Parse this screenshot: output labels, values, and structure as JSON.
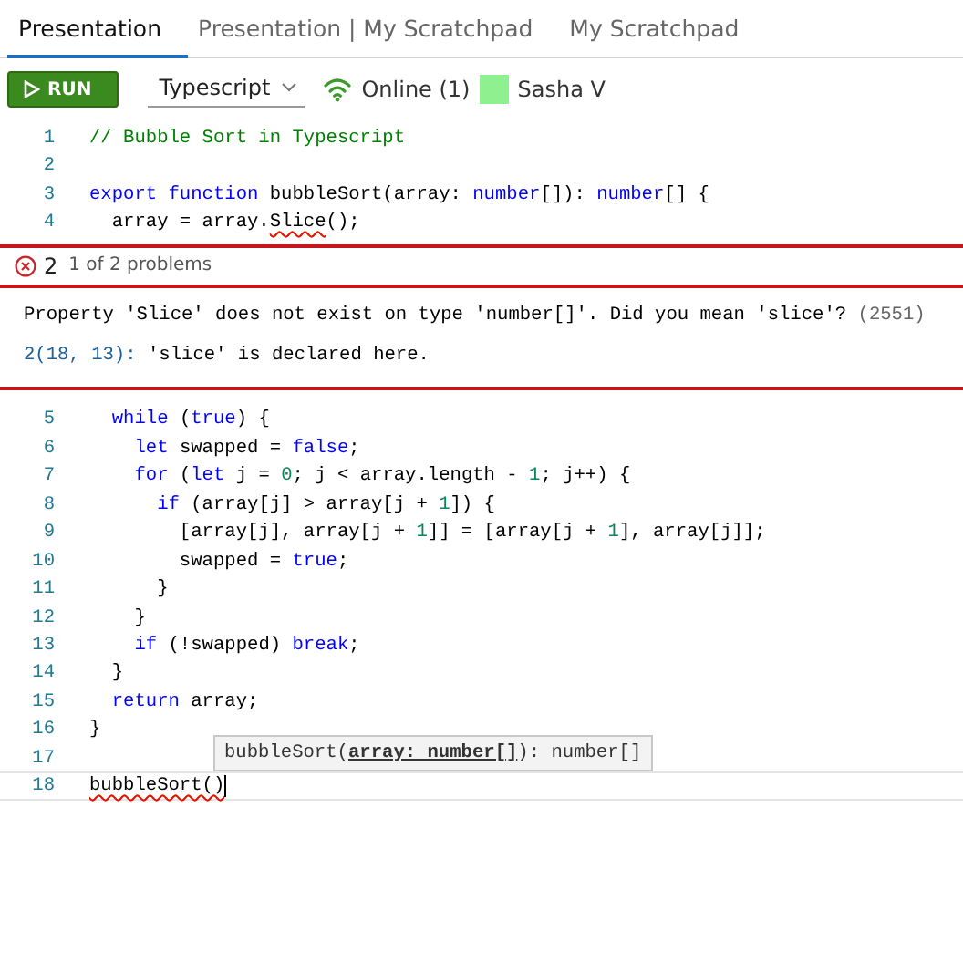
{
  "tabs": [
    {
      "label": "Presentation",
      "selected": true
    },
    {
      "label": "Presentation | My Scratchpad",
      "selected": false
    },
    {
      "label": "My Scratchpad",
      "selected": false
    }
  ],
  "toolbar": {
    "run_button": "RUN",
    "language": "Typescript",
    "status": "Online (1)",
    "user": {
      "name": "Sasha V",
      "color": "#8ef08e"
    }
  },
  "editor": {
    "lines_before": [
      {
        "number": "1",
        "current": false,
        "tokens": [
          {
            "text": "// Bubble Sort in Typescript",
            "kind": "comment"
          }
        ]
      },
      {
        "number": "2",
        "current": false
      },
      {
        "number": "3",
        "current": false,
        "tokens": [
          {
            "text": "export",
            "kind": "keyword"
          },
          {
            "text": " function",
            "kind": "keyword"
          },
          {
            "text": " bubbleSort(array: ",
            "kind": "plain"
          },
          {
            "text": "number",
            "kind": "keyword"
          },
          {
            "text": "[]): ",
            "kind": "plain"
          },
          {
            "text": "number",
            "kind": "keyword"
          },
          {
            "text": "[] {",
            "kind": "plain"
          }
        ]
      },
      {
        "number": "4",
        "current": false,
        "tokens": [
          {
            "text": "  array = array.",
            "kind": "plain"
          },
          {
            "text": "Slice",
            "kind": "error"
          },
          {
            "text": "();",
            "kind": "plain"
          }
        ]
      }
    ],
    "problem_peek": {
      "count": "2",
      "position": "1 of 2 problems",
      "message": "Property 'Slice' does not exist on type 'number[]'. Did you mean 'slice'?",
      "code": "(2551)",
      "related_location": "2(18, 13):",
      "related_message": "'slice' is declared here."
    },
    "lines_after": [
      {
        "number": "5",
        "current": false,
        "tokens": [
          {
            "text": "  while",
            "kind": "keyword"
          },
          {
            "text": " (",
            "kind": "plain"
          },
          {
            "text": "true",
            "kind": "keyword"
          },
          {
            "text": ") {",
            "kind": "plain"
          }
        ]
      },
      {
        "number": "6",
        "current": false,
        "tokens": [
          {
            "text": "    let",
            "kind": "keyword"
          },
          {
            "text": " swapped = ",
            "kind": "plain"
          },
          {
            "text": "false",
            "kind": "keyword"
          },
          {
            "text": ";",
            "kind": "plain"
          }
        ]
      },
      {
        "number": "7",
        "current": false,
        "tokens": [
          {
            "text": "    for",
            "kind": "keyword"
          },
          {
            "text": " (",
            "kind": "plain"
          },
          {
            "text": "let",
            "kind": "keyword"
          },
          {
            "text": " j = ",
            "kind": "plain"
          },
          {
            "text": "0",
            "kind": "number"
          },
          {
            "text": "; j < array.length - ",
            "kind": "plain"
          },
          {
            "text": "1",
            "kind": "number"
          },
          {
            "text": "; j++) {",
            "kind": "plain"
          }
        ]
      },
      {
        "number": "8",
        "current": false,
        "tokens": [
          {
            "text": "      if",
            "kind": "keyword"
          },
          {
            "text": " (array[j] > array[j + ",
            "kind": "plain"
          },
          {
            "text": "1",
            "kind": "number"
          },
          {
            "text": "]) {",
            "kind": "plain"
          }
        ]
      },
      {
        "number": "9",
        "current": false,
        "tokens": [
          {
            "text": "        [array[j], array[j + ",
            "kind": "plain"
          },
          {
            "text": "1",
            "kind": "number"
          },
          {
            "text": "]] = [array[j + ",
            "kind": "plain"
          },
          {
            "text": "1",
            "kind": "number"
          },
          {
            "text": "], array[j]];",
            "kind": "plain"
          }
        ]
      },
      {
        "number": "10",
        "current": false,
        "tokens": [
          {
            "text": "        swapped = ",
            "kind": "plain"
          },
          {
            "text": "true",
            "kind": "keyword"
          },
          {
            "text": ";",
            "kind": "plain"
          }
        ]
      },
      {
        "number": "11",
        "current": false,
        "tokens": [
          {
            "text": "      }",
            "kind": "plain"
          }
        ]
      },
      {
        "number": "12",
        "current": false,
        "tokens": [
          {
            "text": "    }",
            "kind": "plain"
          }
        ]
      },
      {
        "number": "13",
        "current": false,
        "tokens": [
          {
            "text": "    if",
            "kind": "keyword"
          },
          {
            "text": " (!swapped) ",
            "kind": "plain"
          },
          {
            "text": "break",
            "kind": "keyword"
          },
          {
            "text": ";",
            "kind": "plain"
          }
        ]
      },
      {
        "number": "14",
        "current": false,
        "tokens": [
          {
            "text": "  }",
            "kind": "plain"
          }
        ]
      },
      {
        "number": "15",
        "current": false,
        "tokens": [
          {
            "text": "  return",
            "kind": "keyword"
          },
          {
            "text": " array;",
            "kind": "plain"
          }
        ]
      },
      {
        "number": "16",
        "current": false,
        "tokens": [
          {
            "text": "}",
            "kind": "plain"
          }
        ]
      },
      {
        "number": "17",
        "current": false
      },
      {
        "number": "18",
        "current": true,
        "tokens": [
          {
            "text": "bubbleSort()",
            "kind": "error"
          }
        ]
      }
    ],
    "signature_hint": [
      {
        "text": "bubbleSort(",
        "kind": "plain"
      },
      {
        "text": "array: number[]",
        "kind": "active"
      },
      {
        "text": "): number[]",
        "kind": "plain"
      }
    ]
  }
}
